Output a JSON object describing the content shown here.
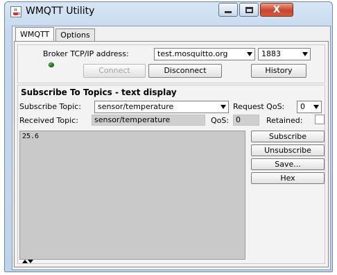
{
  "window": {
    "title": "WMQTT Utility",
    "close_glyph": "X"
  },
  "tabs": [
    {
      "label": "WMQTT",
      "active": true
    },
    {
      "label": "Options",
      "active": false
    }
  ],
  "broker": {
    "address_label": "Broker TCP/IP address:",
    "address_value": "test.mosquitto.org",
    "port_value": "1883",
    "connected_led_color": "#1f8a1f",
    "connect_label": "Connect",
    "connect_enabled": false,
    "disconnect_label": "Disconnect",
    "history_label": "History"
  },
  "subscribe": {
    "section_title": "Subscribe To Topics - text display",
    "topic_label": "Subscribe Topic:",
    "topic_value": "sensor/temperature",
    "request_qos_label": "Request QoS:",
    "request_qos_value": "0",
    "received_topic_label": "Received Topic:",
    "received_topic_value": "sensor/temperature",
    "qos_label": "QoS:",
    "qos_value": "0",
    "retained_label": "Retained:",
    "message_text": "25.6",
    "buttons": {
      "subscribe": "Subscribe",
      "unsubscribe": "Unsubscribe",
      "save": "Save...",
      "hex": "Hex"
    }
  },
  "icons": [
    "java-app-icon",
    "minimize-icon",
    "maximize-icon",
    "close-icon",
    "status-led-icon",
    "chevron-down-icon",
    "scroll-up-icon",
    "scroll-down-icon"
  ]
}
